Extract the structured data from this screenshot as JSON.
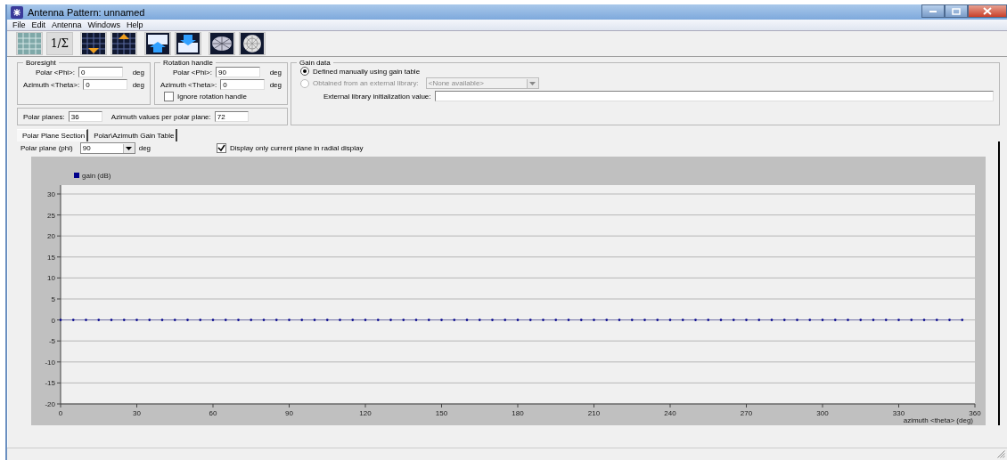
{
  "window": {
    "title": "Antenna Pattern: unnamed"
  },
  "menu": [
    "File",
    "Edit",
    "Antenna",
    "Windows",
    "Help"
  ],
  "toolbar": [
    {
      "kind": "grid"
    },
    {
      "kind": "text",
      "label": "1/Σ"
    },
    {
      "kind": "grid-down"
    },
    {
      "kind": "grid-up"
    },
    {
      "kind": "table-up"
    },
    {
      "kind": "table-down"
    },
    {
      "kind": "mesh"
    },
    {
      "kind": "polar"
    }
  ],
  "boresight": {
    "title": "Boresight",
    "fields": [
      {
        "label": "Polar <Phi>:",
        "value": "0",
        "unit": "deg"
      },
      {
        "label": "Azimuth <Theta>:",
        "value": "0",
        "unit": "deg"
      }
    ]
  },
  "rotation_handle": {
    "title": "Rotation handle",
    "fields": [
      {
        "label": "Polar <Phi>:",
        "value": "90",
        "unit": "deg"
      },
      {
        "label": "Azimuth <Theta>:",
        "value": "0",
        "unit": "deg"
      }
    ],
    "ignore": {
      "label": "Ignore rotation handle",
      "checked": false
    }
  },
  "planes": {
    "polar_label": "Polar planes:",
    "polar_value": "36",
    "azimuth_label": "Azimuth values per polar plane:",
    "azimuth_value": "72"
  },
  "gain_data": {
    "title": "Gain data",
    "options": [
      {
        "label": "Defined manually using gain table",
        "selected": true,
        "disabled": false
      },
      {
        "label": "Obtained from an external library:",
        "selected": false,
        "disabled": true
      }
    ],
    "library": {
      "value": "<None available>",
      "disabled": true
    },
    "init_label": "External library initialization value:"
  },
  "tabs": [
    {
      "label": "Polar Plane Section",
      "selected": true
    },
    {
      "label": "Polar\\Azimuth Gain Table",
      "selected": false
    }
  ],
  "polar_plane": {
    "label": "Polar plane (phi)",
    "value": "90",
    "unit": "deg"
  },
  "display_only": {
    "label": "Display only current plane in radial display",
    "checked": true
  },
  "chart": {
    "chart_data": {
      "type": "line",
      "grid": true,
      "xlabel": "azimuth <theta> (deg)",
      "xlim": [
        0,
        360
      ],
      "ylim": [
        -20,
        30
      ],
      "xticks": [
        0,
        30,
        60,
        90,
        120,
        150,
        180,
        210,
        240,
        270,
        300,
        330,
        360
      ],
      "yticks": [
        -20,
        -15,
        -10,
        -5,
        0,
        5,
        10,
        15,
        20,
        25,
        30
      ],
      "x": [
        0,
        5,
        10,
        15,
        20,
        25,
        30,
        35,
        40,
        45,
        50,
        55,
        60,
        65,
        70,
        75,
        80,
        85,
        90,
        95,
        100,
        105,
        110,
        115,
        120,
        125,
        130,
        135,
        140,
        145,
        150,
        155,
        160,
        165,
        170,
        175,
        180,
        185,
        190,
        195,
        200,
        205,
        210,
        215,
        220,
        225,
        230,
        235,
        240,
        245,
        250,
        255,
        260,
        265,
        270,
        275,
        280,
        285,
        290,
        295,
        300,
        305,
        310,
        315,
        320,
        325,
        330,
        335,
        340,
        345,
        350,
        355
      ],
      "series": [
        {
          "name": "gain (dB)",
          "color": "#00008b",
          "values": [
            0,
            0,
            0,
            0,
            0,
            0,
            0,
            0,
            0,
            0,
            0,
            0,
            0,
            0,
            0,
            0,
            0,
            0,
            0,
            0,
            0,
            0,
            0,
            0,
            0,
            0,
            0,
            0,
            0,
            0,
            0,
            0,
            0,
            0,
            0,
            0,
            0,
            0,
            0,
            0,
            0,
            0,
            0,
            0,
            0,
            0,
            0,
            0,
            0,
            0,
            0,
            0,
            0,
            0,
            0,
            0,
            0,
            0,
            0,
            0,
            0,
            0,
            0,
            0,
            0,
            0,
            0,
            0,
            0,
            0,
            0,
            0
          ]
        }
      ]
    }
  }
}
